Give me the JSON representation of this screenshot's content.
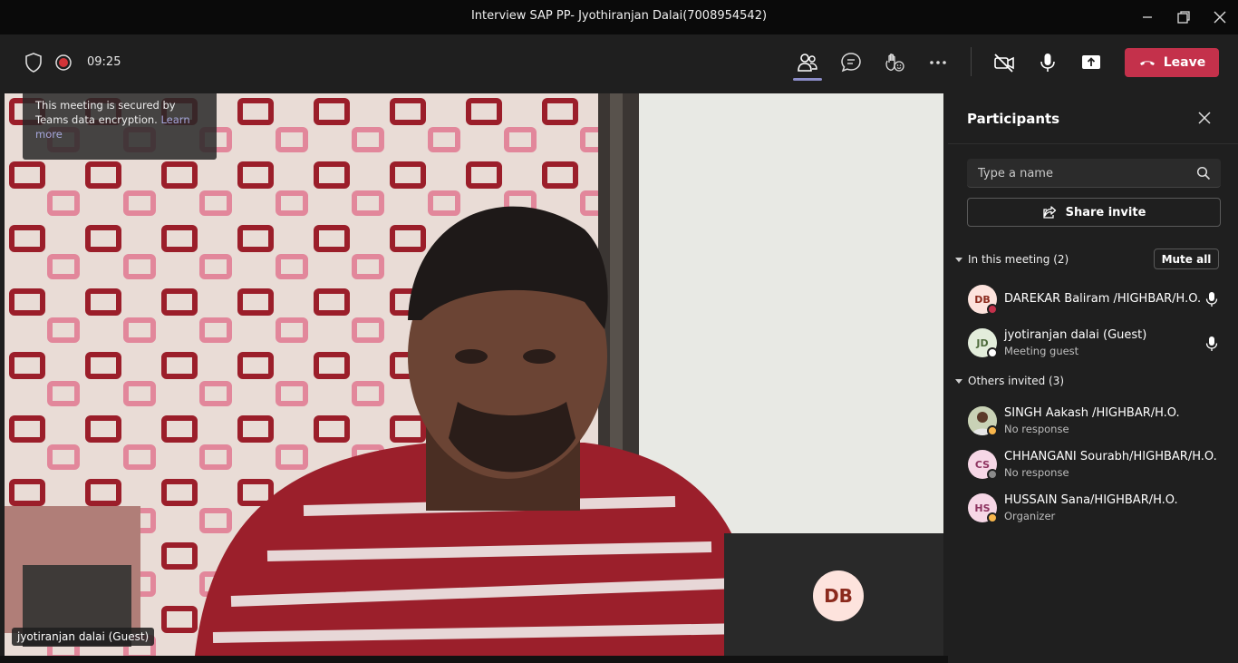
{
  "window": {
    "title": "Interview SAP PP- Jyothiranjan Dalai(7008954542)"
  },
  "toolbar": {
    "timer": "09:25",
    "leave_label": "Leave"
  },
  "stage": {
    "encryption_text": "This meeting is secured by Teams data encryption.",
    "encryption_link": "Learn more",
    "video_name": "jyotiranjan dalai (Guest)",
    "self_initials": "DB"
  },
  "panel": {
    "title": "Participants",
    "search_placeholder": "Type a name",
    "share_label": "Share invite",
    "in_meeting_label": "In this meeting (2)",
    "mute_all_label": "Mute all",
    "others_label": "Others invited (3)",
    "in_meeting": [
      {
        "initials": "DB",
        "name": "DAREKAR Baliram /HIGHBAR/H.O.",
        "sub": "",
        "avatar_bg": "#fde3dd",
        "avatar_fg": "#8b2a1d",
        "status_color": "#c4314b"
      },
      {
        "initials": "JD",
        "name": "jyotiranjan dalai (Guest)",
        "sub": "Meeting guest",
        "avatar_bg": "#e3eddb",
        "avatar_fg": "#4e6b3c",
        "status_color": "#ffffff"
      }
    ],
    "others": [
      {
        "initials": "",
        "name": "SINGH Aakash /HIGHBAR/H.O.",
        "sub": "No response",
        "avatar_bg": "#7a8b5e",
        "avatar_fg": "#fff",
        "status_color": "#f8b64c"
      },
      {
        "initials": "CS",
        "name": "CHHANGANI Sourabh/HIGHBAR/H.O.",
        "sub": "No response",
        "avatar_bg": "#f6d7e6",
        "avatar_fg": "#8e3360",
        "status_color": "#8a8a8a"
      },
      {
        "initials": "HS",
        "name": "HUSSAIN Sana/HIGHBAR/H.O.",
        "sub": "Organizer",
        "avatar_bg": "#f6d7e6",
        "avatar_fg": "#8e3360",
        "status_color": "#f8b64c"
      }
    ]
  },
  "colors": {
    "accent": "#8b8cc7",
    "leave": "#c4314b",
    "panel_bg": "#1f1f1f"
  }
}
